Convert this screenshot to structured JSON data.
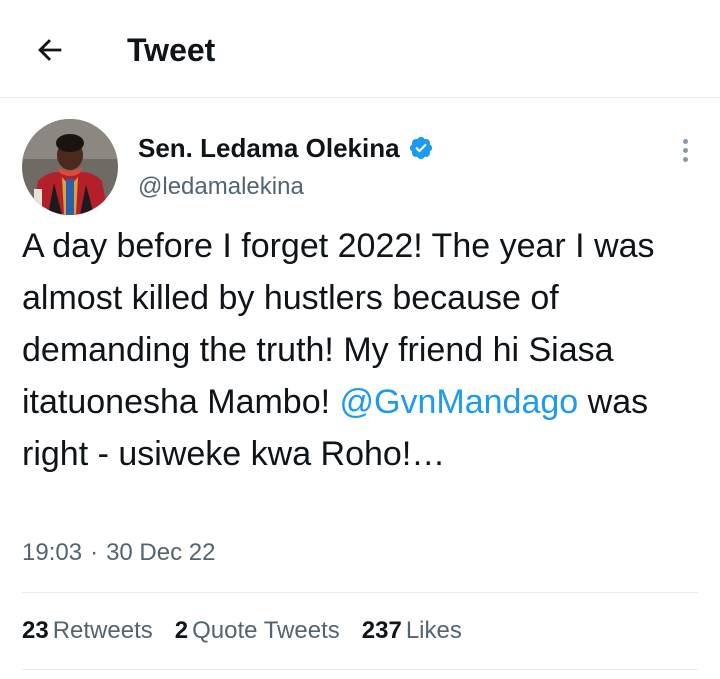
{
  "header": {
    "back_icon": "arrow-left-icon",
    "title": "Tweet"
  },
  "author": {
    "display_name": "Sen. Ledama Olekina",
    "handle": "@ledamalekina",
    "verified_icon": "verified-badge-icon",
    "verified_color": "#1d9bf0"
  },
  "tweet": {
    "text_part1": "A day before I forget 2022! The year I was almost killed by hustlers because of demanding the truth! My friend hi Siasa itatuonesha Mambo! ",
    "mention": "@GvnMandago",
    "text_part2": " was right - usiweke kwa Roho!…",
    "time": "19:03",
    "separator": "·",
    "date": "30 Dec 22"
  },
  "stats": {
    "retweets_count": "23",
    "retweets_label": "Retweets",
    "quotes_count": "2",
    "quotes_label": "Quote Tweets",
    "likes_count": "237",
    "likes_label": "Likes"
  },
  "colors": {
    "accent": "#1d9bf0",
    "text": "#0f1419",
    "secondary": "#536471",
    "divider": "#e6ecf0"
  }
}
